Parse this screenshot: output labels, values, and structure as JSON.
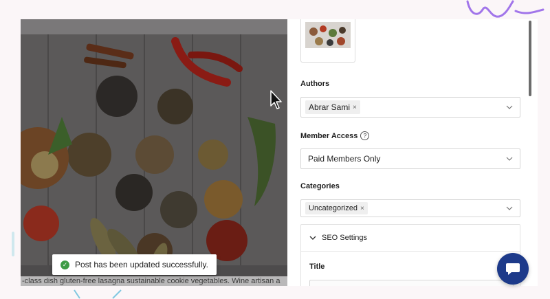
{
  "preview": {
    "body_text": "-class dish gluten-free lasagna sustainable cookie vegetables. Wine artisan a"
  },
  "toast": {
    "message": "Post has been updated successfully.",
    "icon": "check-circle-icon"
  },
  "sidebar": {
    "authors": {
      "label": "Authors",
      "selected": [
        "Abrar Sami"
      ],
      "remove_glyph": "×"
    },
    "member_access": {
      "label": "Member Access",
      "help_glyph": "?",
      "value": "Paid Members Only"
    },
    "categories": {
      "label": "Categories",
      "selected": [
        "Uncategorized"
      ],
      "remove_glyph": "×"
    },
    "seo": {
      "heading": "SEO Settings",
      "title_label": "Title"
    }
  },
  "colors": {
    "accent": "#1d3a8a",
    "success": "#3e9c45",
    "deco": "#7b3fe4"
  },
  "icons": [
    "chevron-down-icon",
    "help-icon",
    "chat-icon",
    "cursor-icon"
  ]
}
